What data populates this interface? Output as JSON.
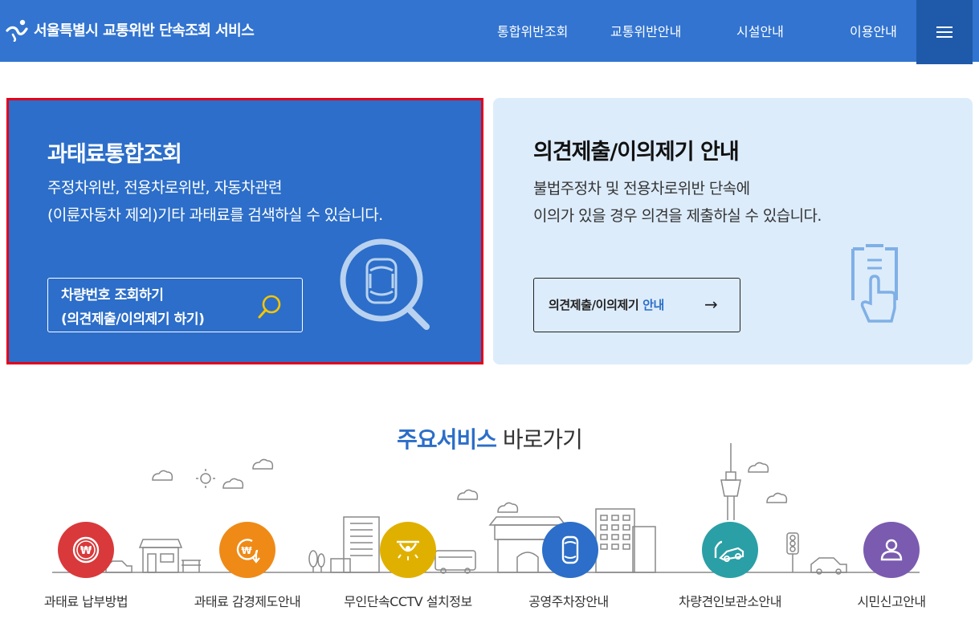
{
  "header": {
    "title": "서울특별시 교통위반 단속조회 서비스",
    "nav": [
      "통합위반조회",
      "교통위반안내",
      "시설안내",
      "이용안내"
    ],
    "menu_icon": "hamburger-menu-icon"
  },
  "search_card": {
    "title": "과태료통합조회",
    "desc_line1": "주정차위반, 전용차로위반, 자동차관련",
    "desc_line2": "(이륜자동차 제외)기타 과태료를 검색하실 수 있습니다.",
    "button_line1": "차량번호 조회하기",
    "button_line2": "(의견제출/이의제기 하기)",
    "button_icon": "search-icon"
  },
  "objection_card": {
    "title": "의견제출/이의제기 안내",
    "desc_line1": "불법주정차 및 전용차로위반 단속에",
    "desc_line2": "이의가 있을 경우 의견을 제출하실 수 있습니다.",
    "button_main": "의견제출/이의제기 ",
    "button_accent": "안내",
    "button_arrow": "→"
  },
  "services": {
    "heading_highlight": "주요서비스",
    "heading_rest": " 바로가기",
    "items": [
      {
        "label": "과태료 납부방법",
        "color": "#d9393b",
        "icon": "won-coin-icon"
      },
      {
        "label": "과태료 감경제도안내",
        "color": "#ef8a17",
        "icon": "won-discount-icon"
      },
      {
        "label": "무인단속CCTV 설치정보",
        "color": "#e0b000",
        "icon": "cctv-camera-icon"
      },
      {
        "label": "공영주차장안내",
        "color": "#2c6ec9",
        "icon": "parking-car-icon"
      },
      {
        "label": "차량견인보관소안내",
        "color": "#2a9fa6",
        "icon": "tow-truck-icon"
      },
      {
        "label": "시민신고안내",
        "color": "#7a5bb0",
        "icon": "person-icon"
      }
    ]
  }
}
